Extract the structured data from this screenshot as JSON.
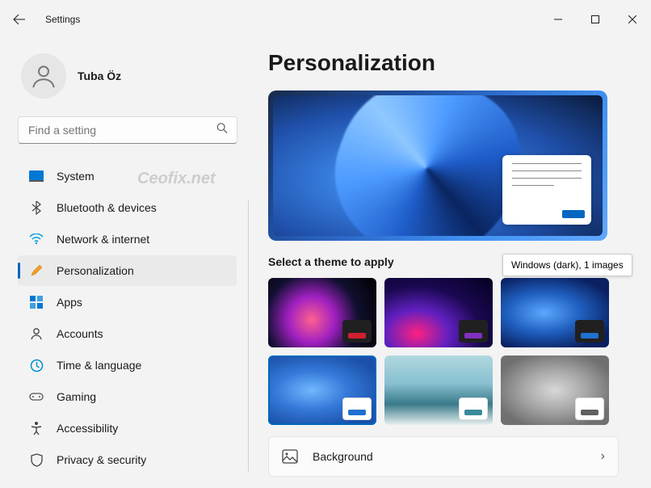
{
  "window": {
    "title": "Settings"
  },
  "user": {
    "name": "Tuba Öz"
  },
  "search": {
    "placeholder": "Find a setting"
  },
  "nav": {
    "items": [
      {
        "label": "System"
      },
      {
        "label": "Bluetooth & devices"
      },
      {
        "label": "Network & internet"
      },
      {
        "label": "Personalization"
      },
      {
        "label": "Apps"
      },
      {
        "label": "Accounts"
      },
      {
        "label": "Time & language"
      },
      {
        "label": "Gaming"
      },
      {
        "label": "Accessibility"
      },
      {
        "label": "Privacy & security"
      }
    ],
    "activeIndex": 3
  },
  "page": {
    "title": "Personalization",
    "themeHeading": "Select a theme to apply",
    "tooltip": "Windows (dark), 1 images",
    "themes": [
      {
        "name": "abstract-dark",
        "swatchBg": "#202020",
        "swatchBar": "#d02030"
      },
      {
        "name": "glow-dark",
        "swatchBg": "#202020",
        "swatchBar": "#8030c0"
      },
      {
        "name": "windows-dark",
        "swatchBg": "#202020",
        "swatchBar": "#2070d0"
      },
      {
        "name": "windows-light",
        "swatchBg": "#ffffff",
        "swatchBar": "#2070d0",
        "selected": true
      },
      {
        "name": "sunrise",
        "swatchBg": "#ffffff",
        "swatchBar": "#3a8a9a"
      },
      {
        "name": "flow",
        "swatchBg": "#ffffff",
        "swatchBar": "#606060"
      }
    ],
    "settings": {
      "background": {
        "title": "Background"
      }
    }
  },
  "watermark": "Ceofix.net"
}
